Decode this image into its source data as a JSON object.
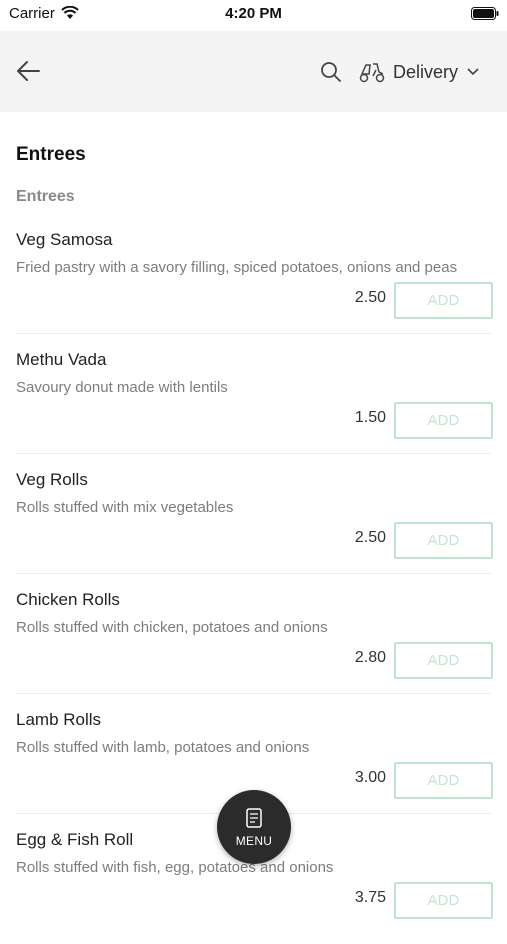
{
  "status_bar": {
    "carrier": "Carrier",
    "time": "4:20 PM"
  },
  "header": {
    "delivery_label": "Delivery"
  },
  "section": {
    "title": "Entrees",
    "subtitle": "Entrees"
  },
  "items": [
    {
      "name": "Veg Samosa",
      "description": "Fried pastry with a savory filling, spiced potatoes, onions and peas",
      "price": "2.50",
      "add_label": "ADD"
    },
    {
      "name": "Methu Vada",
      "description": "Savoury donut made with lentils",
      "price": "1.50",
      "add_label": "ADD"
    },
    {
      "name": "Veg Rolls",
      "description": "Rolls stuffed with mix vegetables",
      "price": "2.50",
      "add_label": "ADD"
    },
    {
      "name": "Chicken Rolls",
      "description": "Rolls stuffed with chicken, potatoes and onions",
      "price": "2.80",
      "add_label": "ADD"
    },
    {
      "name": "Lamb Rolls",
      "description": "Rolls stuffed with lamb, potatoes and onions",
      "price": "3.00",
      "add_label": "ADD"
    },
    {
      "name": "Egg & Fish Roll",
      "description": "Rolls stuffed with fish, egg, potatoes and onions",
      "price": "3.75",
      "add_label": "ADD"
    }
  ],
  "menu_button": {
    "label": "MENU"
  },
  "colors": {
    "add_border": "#bfe3cc",
    "add_text": "#c4e6d0",
    "header_bg": "#f4f4f4",
    "fab_bg": "#2b2b2b"
  }
}
